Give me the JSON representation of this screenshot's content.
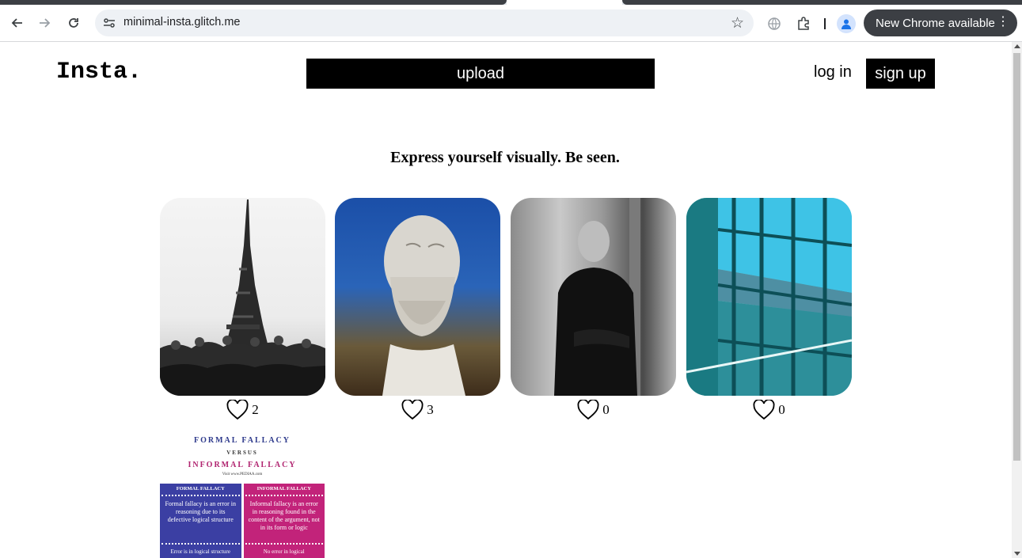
{
  "browser": {
    "url": "minimal-insta.glitch.me",
    "update_label": "New Chrome available"
  },
  "header": {
    "logo": "Insta.",
    "upload_label": "upload",
    "login_label": "log in",
    "signup_label": "sign up"
  },
  "main": {
    "tagline": "Express yourself visually. Be seen.",
    "posts": [
      {
        "subject": "eiffel-tower",
        "likes": "2"
      },
      {
        "subject": "statue-bust",
        "likes": "3"
      },
      {
        "subject": "man-portrait",
        "likes": "0"
      },
      {
        "subject": "windows-view",
        "likes": "0"
      }
    ],
    "fallacy_post": {
      "title1": "FORMAL FALLACY",
      "versus": "VERSUS",
      "title2": "INFORMAL FALLACY",
      "source": "Visit www.PEDIAA.com",
      "left_head": "FORMAL FALLACY",
      "left_body": "Formal fallacy is an error in reasoning due to its defective logical structure",
      "left_foot": "Error is in logical structure",
      "right_head": "INFORMAL FALLACY",
      "right_body": "Informal fallacy is an error in reasoning found in the content of the argument, not in its form or logic",
      "right_foot": "No error in logical"
    }
  },
  "colors": {
    "primary": "#000000",
    "chrome_dark": "#3c3f44",
    "omnibox": "#eef1f5"
  }
}
